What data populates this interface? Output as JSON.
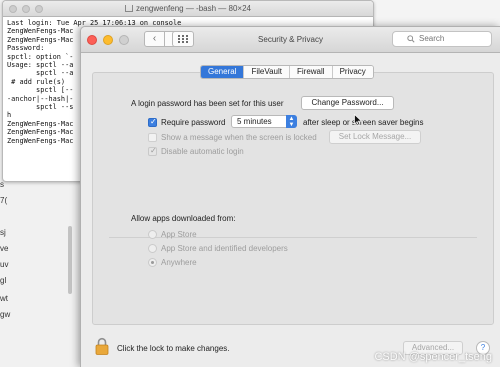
{
  "background_sidebar": {
    "items": [
      "s",
      "7(",
      "sj",
      "ve",
      "uv",
      "gl",
      "wt",
      "gw"
    ]
  },
  "terminal": {
    "title": "zengwenfeng — -bash — 80×24",
    "lines": [
      "Last login: Tue Apr 25 17:06:13 on console",
      "ZengWenFengs-Mac",
      "ZengWenFengs-Mac",
      "Password:",
      "spctl: option `-",
      "Usage: spctl --a",
      "       spctl --a",
      " # add rule(s)",
      "       spctl [--",
      "-anchor|--hash|-",
      "       spctl --s",
      "h",
      "ZengWenFengs-Mac",
      "ZengWenFengs-Mac",
      "ZengWenFengs-Mac"
    ]
  },
  "window": {
    "title": "Security & Privacy",
    "search_placeholder": "Search"
  },
  "tabs": [
    {
      "label": "General",
      "active": true
    },
    {
      "label": "FileVault",
      "active": false
    },
    {
      "label": "Firewall",
      "active": false
    },
    {
      "label": "Privacy",
      "active": false
    }
  ],
  "general": {
    "login_password_text": "A login password has been set for this user",
    "change_password_label": "Change Password...",
    "require_password_label": "Require password",
    "require_password_checked": true,
    "require_password_delay": "5 minutes",
    "after_sleep_label": "after sleep or screen saver begins",
    "show_message_label": "Show a message when the screen is locked",
    "show_message_checked": false,
    "set_lock_message_label": "Set Lock Message...",
    "disable_auto_login_label": "Disable automatic login",
    "disable_auto_login_checked": true
  },
  "apps_download": {
    "heading": "Allow apps downloaded from:",
    "options": [
      {
        "label": "App Store",
        "selected": false
      },
      {
        "label": "App Store and identified developers",
        "selected": false
      },
      {
        "label": "Anywhere",
        "selected": true
      }
    ]
  },
  "footer": {
    "lock_text": "Click the lock to make changes.",
    "advanced_label": "Advanced...",
    "help_label": "?"
  },
  "watermark": "CSDN @spencer_tseng",
  "colors": {
    "accent": "#3477d9",
    "close": "#fc5f57",
    "minimize": "#fdbc2e"
  }
}
